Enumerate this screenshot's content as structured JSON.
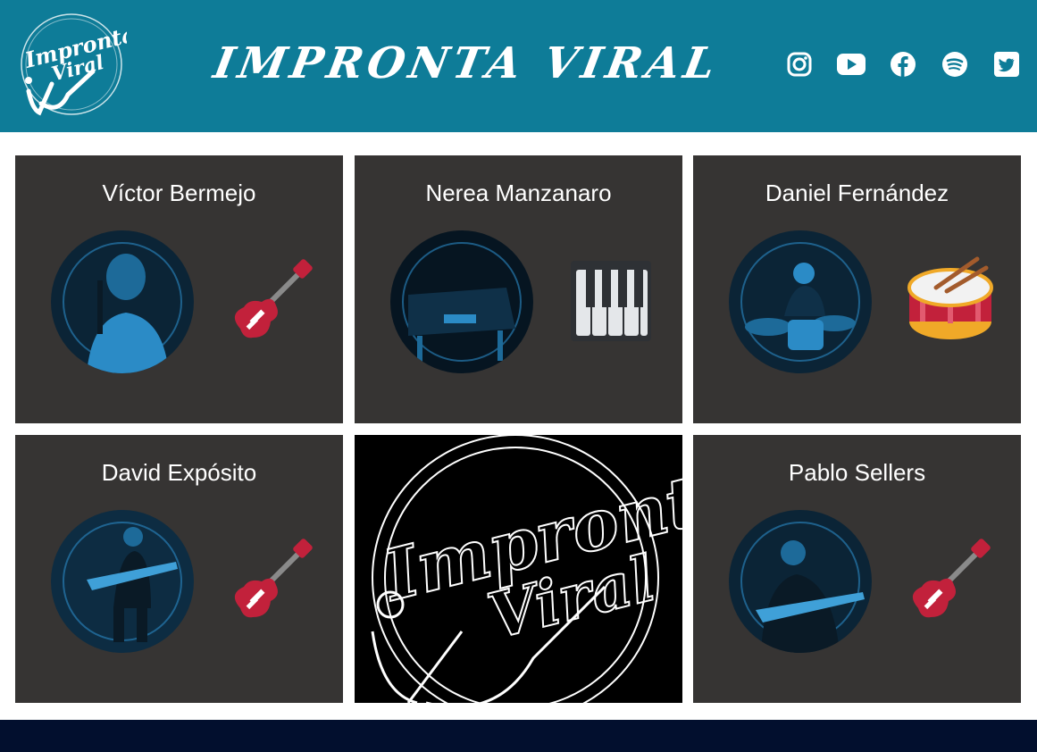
{
  "header": {
    "title": "IMPRONTA VIRAL",
    "logo_text_line1": "Impronta",
    "logo_text_line2": "Viral",
    "background": "#0e7c98",
    "socials": [
      {
        "name": "instagram-icon"
      },
      {
        "name": "youtube-icon"
      },
      {
        "name": "facebook-icon"
      },
      {
        "name": "spotify-icon"
      },
      {
        "name": "twitter-icon"
      }
    ]
  },
  "members": [
    {
      "name": "Víctor Bermejo",
      "instrument": "guitar-icon"
    },
    {
      "name": "Nerea Manzanaro",
      "instrument": "piano-keys-icon"
    },
    {
      "name": "Daniel Fernández",
      "instrument": "drum-icon"
    },
    {
      "name": "David Expósito",
      "instrument": "guitar-icon"
    },
    {
      "name": "Pablo Sellers",
      "instrument": "guitar-icon"
    }
  ],
  "logo_card": {
    "line1": "Impronta",
    "line2": "Viral"
  },
  "colors": {
    "card": "#363433",
    "footer": "#020f2e",
    "photo_tint": "#1a7bb0",
    "guitar_red": "#c2213b"
  }
}
